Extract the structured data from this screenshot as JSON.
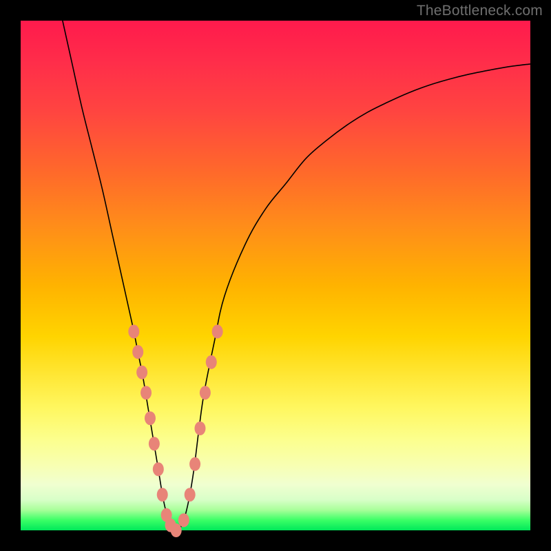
{
  "watermark": "TheBottleneck.com",
  "chart_data": {
    "type": "line",
    "title": "",
    "xlabel": "",
    "ylabel": "",
    "xlim": [
      0,
      100
    ],
    "ylim": [
      0,
      100
    ],
    "series": [
      {
        "name": "curve",
        "x": [
          8,
          10,
          12,
          14,
          16,
          18,
          20,
          22,
          23,
          24,
          25,
          26,
          27,
          28,
          29,
          30,
          30.5,
          31,
          32,
          33,
          34,
          35,
          36,
          38,
          40,
          44,
          48,
          52,
          56,
          60,
          64,
          68,
          72,
          76,
          80,
          84,
          88,
          92,
          96,
          100
        ],
        "y": [
          101,
          92,
          83,
          75,
          67,
          58,
          49,
          40,
          35,
          30,
          24,
          18,
          12,
          6,
          2,
          0,
          0,
          0,
          2,
          6,
          12,
          20,
          27,
          37,
          46,
          56,
          63,
          68,
          73,
          76.5,
          79.5,
          82,
          84,
          85.8,
          87.3,
          88.5,
          89.5,
          90.3,
          91,
          91.5
        ]
      }
    ],
    "markers": {
      "name": "highlighted-points",
      "x": [
        22.2,
        23.0,
        23.8,
        24.6,
        25.4,
        26.2,
        27.0,
        27.8,
        28.6,
        29.4,
        30.5,
        32.0,
        33.2,
        34.2,
        35.2,
        36.2,
        37.4,
        38.6
      ],
      "y": [
        39,
        35,
        31,
        27,
        22,
        17,
        12,
        7,
        3,
        1,
        0,
        2,
        7,
        13,
        20,
        27,
        33,
        39
      ]
    }
  }
}
